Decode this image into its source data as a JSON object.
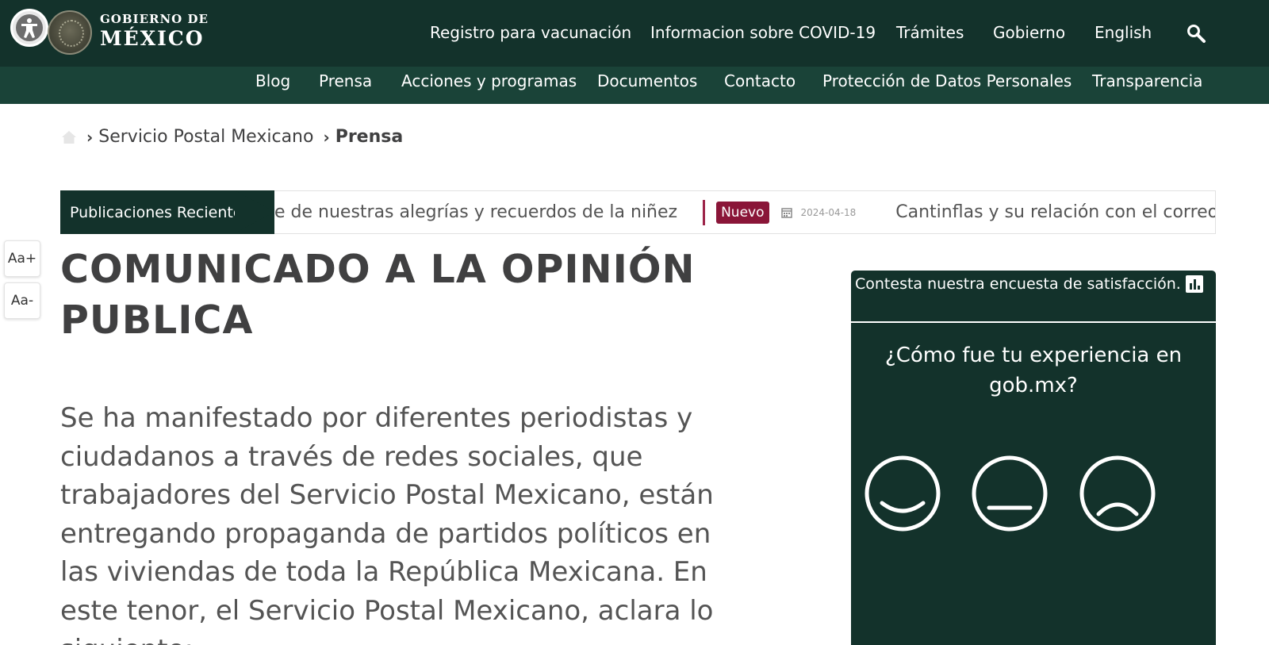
{
  "header": {
    "brand_line1": "GOBIERNO DE",
    "brand_line2": "MÉXICO",
    "nav": [
      "Registro para vacunación",
      "Informacion sobre COVID-19",
      "Trámites",
      "Gobierno",
      "English"
    ]
  },
  "subnav": [
    "Blog",
    "Prensa",
    "Acciones y programas",
    "Documentos",
    "Contacto",
    "Protección de Datos Personales",
    "Transparencia"
  ],
  "breadcrumb": {
    "link": "Servicio Postal Mexicano",
    "current": "Prensa"
  },
  "ticker": {
    "label": "Publicaciones Recientes",
    "item1": "e de nuestras alegrías y recuerdos de la niñez",
    "badge": "Nuevo",
    "date": "2024-04-18",
    "item2": "Cantinflas y su relación con el correo postal"
  },
  "font_controls": {
    "increase": "Aa+",
    "decrease": "Aa-"
  },
  "article": {
    "title": "COMUNICADO A LA OPINIÓN PUBLICA",
    "lead": "Se ha manifestado por diferentes periodistas y ciudadanos a través de redes sociales, que trabajadores del Servicio Postal Mexicano, están entregando propaganda de partidos políticos en las viviendas de toda la República Mexicana. En este tenor, el Servicio Postal Mexicano, aclara lo siguiente:"
  },
  "survey": {
    "header": "Contesta nuestra encuesta de satisfacción.",
    "question": "¿Cómo fue tu experiencia en gob.mx?"
  },
  "colors": {
    "primary": "#13322b",
    "secondary": "#1a4338",
    "accent": "#8a1538",
    "text": "#404041"
  },
  "icons": [
    "accessibility-icon",
    "search-icon",
    "home-icon",
    "calendar-icon",
    "bar-chart-icon",
    "happy-face-icon",
    "neutral-face-icon",
    "sad-face-icon"
  ]
}
